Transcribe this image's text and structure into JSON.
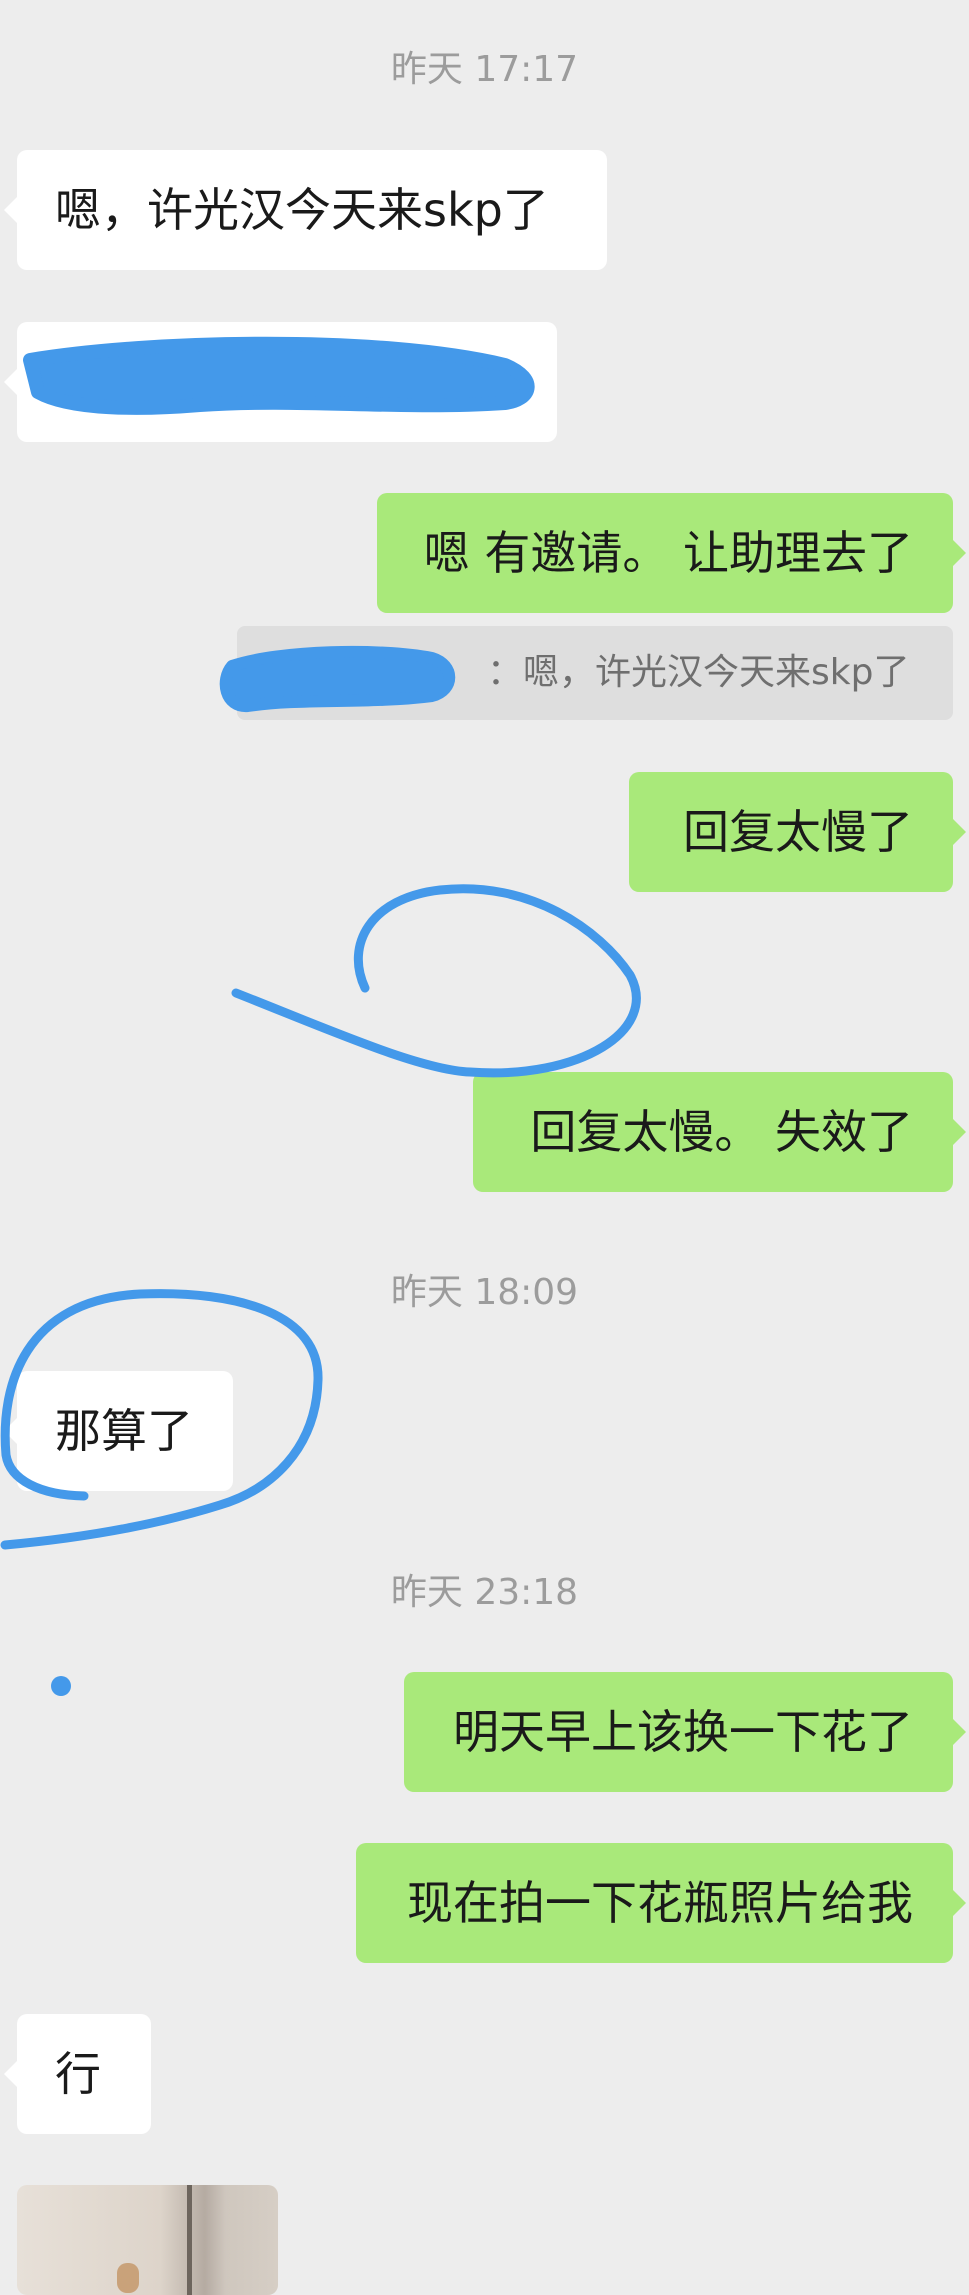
{
  "chat": {
    "timestamps": [
      "昨天 17:17",
      "昨天 18:09",
      "昨天 23:18"
    ],
    "msg1": "嗯，许光汉今天来skp了",
    "msg3": "嗯 有邀请。 让助理去了",
    "quote": "：嗯，许光汉今天来skp了",
    "msg4": "回复太慢了",
    "msg5": "回复太慢。 失效了",
    "msg6": "那算了",
    "msg7": "明天早上该换一下花了",
    "msg8": "现在拍一下花瓶照片给我",
    "msg9": "行"
  },
  "colors": {
    "background": "#ededed",
    "incoming_bubble": "#ffffff",
    "outgoing_bubble": "#a9e97a",
    "redaction_marker": "#4499ea"
  }
}
